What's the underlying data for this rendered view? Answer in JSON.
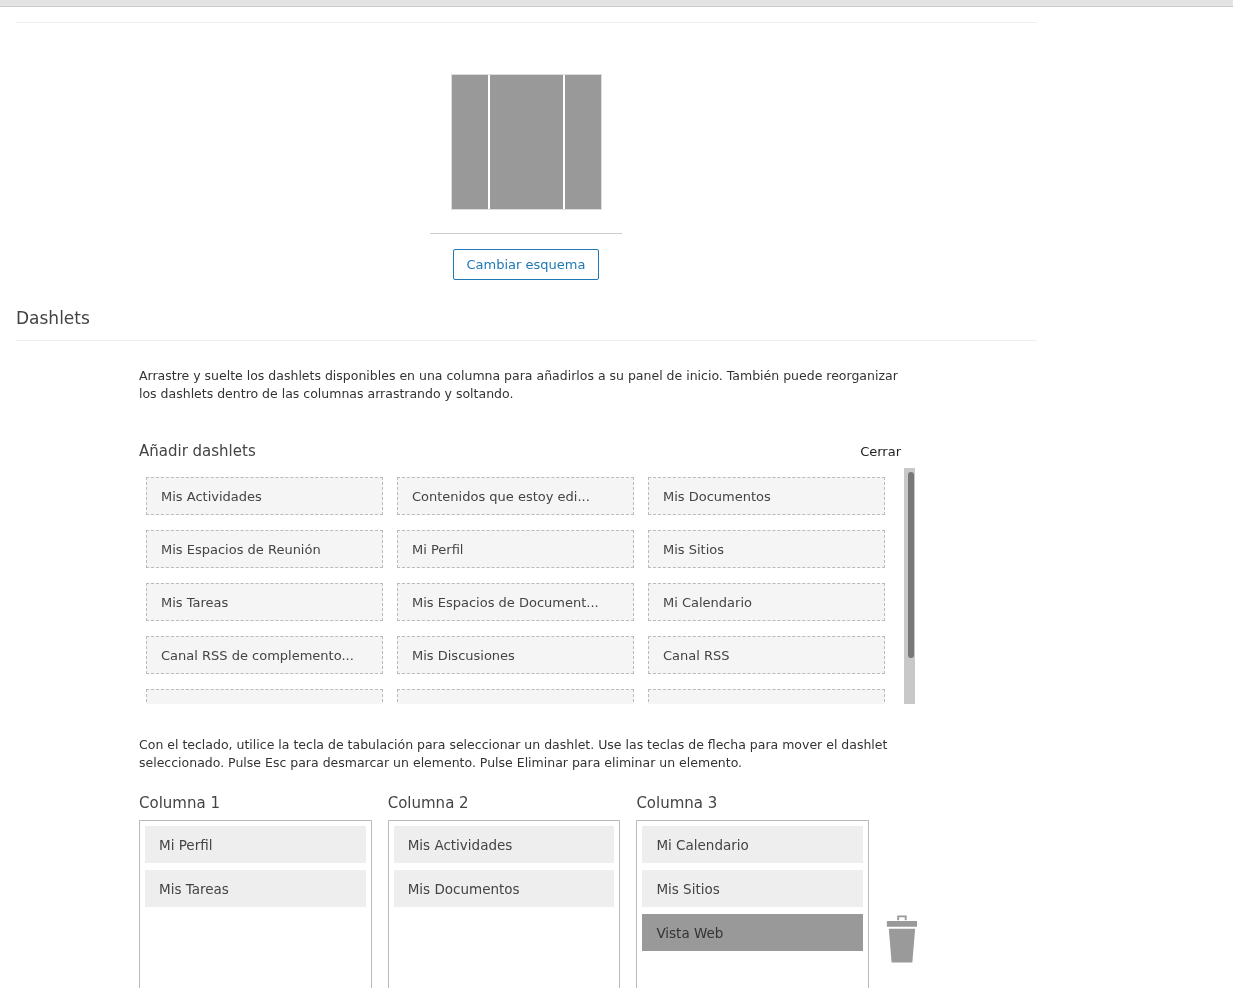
{
  "layout_preview": {
    "columns": [
      {
        "kind": "narrow"
      },
      {
        "kind": "wide"
      },
      {
        "kind": "narrow"
      }
    ]
  },
  "change_layout_button": "Cambiar esquema",
  "section_title": "Dashlets",
  "instructions": "Arrastre y suelte los dashlets disponibles en una columna para añadirlos a su panel de inicio. También puede reorganizar los dashlets dentro de las columnas arrastrando y soltando.",
  "available": {
    "title": "Añadir dashlets",
    "close": "Cerrar",
    "items": [
      {
        "label": "Mis Actividades"
      },
      {
        "label": "Contenidos que estoy edi..."
      },
      {
        "label": "Mis Documentos"
      },
      {
        "label": "Mis Espacios de Reunión"
      },
      {
        "label": "Mi Perfil"
      },
      {
        "label": "Mis Sitios"
      },
      {
        "label": "Mis Tareas"
      },
      {
        "label": "Mis Espacios de Document..."
      },
      {
        "label": "Mi Calendario"
      },
      {
        "label": "Canal RSS de complemento..."
      },
      {
        "label": "Mis Discusiones"
      },
      {
        "label": "Canal RSS"
      }
    ]
  },
  "keyboard_help": "Con el teclado, utilice la tecla de tabulación para seleccionar un dashlet. Use las teclas de flecha para mover el dashlet seleccionado. Pulse Esc para desmarcar un elemento. Pulse Eliminar para eliminar un elemento.",
  "columns": [
    {
      "title": "Columna 1",
      "items": [
        {
          "label": "Mi Perfil",
          "selected": false
        },
        {
          "label": "Mis Tareas",
          "selected": false
        }
      ]
    },
    {
      "title": "Columna 2",
      "items": [
        {
          "label": "Mis Actividades",
          "selected": false
        },
        {
          "label": "Mis Documentos",
          "selected": false
        }
      ]
    },
    {
      "title": "Columna 3",
      "items": [
        {
          "label": "Mi Calendario",
          "selected": false
        },
        {
          "label": "Mis Sitios",
          "selected": false
        },
        {
          "label": "Vista Web",
          "selected": true
        }
      ]
    }
  ]
}
